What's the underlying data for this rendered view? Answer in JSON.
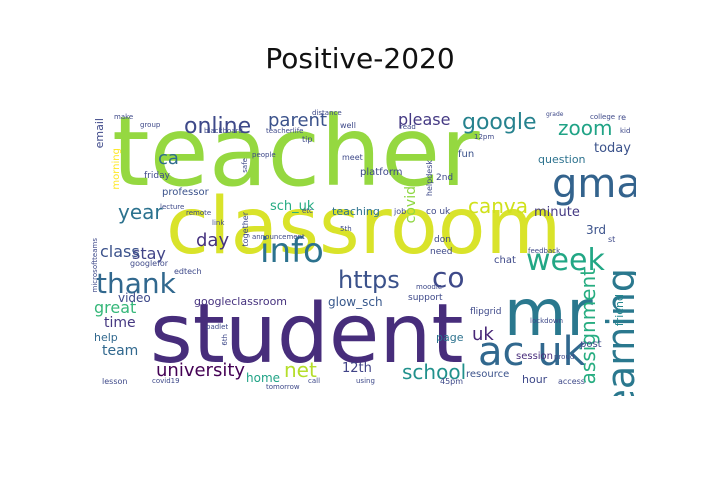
{
  "title": "Positive-2020",
  "words": [
    {
      "text": "teacher",
      "color": "#95d840",
      "orientation": "horizontal"
    },
    {
      "text": "classroom",
      "color": "#d9e32a",
      "orientation": "horizontal"
    },
    {
      "text": "student",
      "color": "#472d7b",
      "orientation": "horizontal"
    },
    {
      "text": "mr",
      "color": "#2a788e",
      "orientation": "horizontal"
    },
    {
      "text": "gmail",
      "color": "#33638d",
      "orientation": "horizontal"
    },
    {
      "text": "info",
      "color": "#2c728e",
      "orientation": "horizontal"
    },
    {
      "text": "ac uk",
      "color": "#31688e",
      "orientation": "horizontal"
    },
    {
      "text": "week",
      "color": "#22a785",
      "orientation": "horizontal"
    },
    {
      "text": "learning",
      "color": "#2a788e",
      "orientation": "vertical"
    },
    {
      "text": "https",
      "color": "#3b528b",
      "orientation": "horizontal"
    },
    {
      "text": "co",
      "color": "#3e4989",
      "orientation": "horizontal"
    },
    {
      "text": "thank",
      "color": "#31688e",
      "orientation": "horizontal"
    },
    {
      "text": "google",
      "color": "#26828e",
      "orientation": "horizontal"
    },
    {
      "text": "online",
      "color": "#3e4989",
      "orientation": "horizontal"
    },
    {
      "text": "zoom",
      "color": "#20a386",
      "orientation": "horizontal"
    },
    {
      "text": "school",
      "color": "#21918c",
      "orientation": "horizontal"
    },
    {
      "text": "net",
      "color": "#b5de2b",
      "orientation": "horizontal"
    },
    {
      "text": "assignment",
      "color": "#27ad81",
      "orientation": "vertical"
    },
    {
      "text": "parent",
      "color": "#3b528b",
      "orientation": "horizontal"
    },
    {
      "text": "please",
      "color": "#443983",
      "orientation": "horizontal"
    },
    {
      "text": "canva",
      "color": "#d0e11c",
      "orientation": "horizontal"
    },
    {
      "text": "year",
      "color": "#2c728e",
      "orientation": "horizontal"
    },
    {
      "text": "university",
      "color": "#440154",
      "orientation": "horizontal"
    },
    {
      "text": "day",
      "color": "#46337f",
      "orientation": "horizontal"
    },
    {
      "text": "ca",
      "color": "#2f6c8e",
      "orientation": "horizontal"
    },
    {
      "text": "stay",
      "color": "#414487",
      "orientation": "horizontal"
    },
    {
      "text": "class",
      "color": "#3b528b",
      "orientation": "horizontal"
    },
    {
      "text": "great",
      "color": "#35b779",
      "orientation": "horizontal"
    },
    {
      "text": "time",
      "color": "#453781",
      "orientation": "horizontal"
    },
    {
      "text": "team",
      "color": "#31688e",
      "orientation": "horizontal"
    },
    {
      "text": "video",
      "color": "#3e4989",
      "orientation": "horizontal"
    },
    {
      "text": "help",
      "color": "#31688e",
      "orientation": "horizontal"
    },
    {
      "text": "uk",
      "color": "#482677",
      "orientation": "horizontal"
    },
    {
      "text": "12th",
      "color": "#414487",
      "orientation": "horizontal"
    },
    {
      "text": "home",
      "color": "#20a386",
      "orientation": "horizontal"
    },
    {
      "text": "today",
      "color": "#3b528b",
      "orientation": "horizontal"
    },
    {
      "text": "minute",
      "color": "#443983",
      "orientation": "horizontal"
    },
    {
      "text": "question",
      "color": "#2c728e",
      "orientation": "horizontal"
    },
    {
      "text": "sch_uk",
      "color": "#25ab82",
      "orientation": "horizontal"
    },
    {
      "text": "teaching",
      "color": "#2c728e",
      "orientation": "horizontal"
    },
    {
      "text": "covid",
      "color": "#8fd744",
      "orientation": "vertical"
    },
    {
      "text": "glow_sch",
      "color": "#38588c",
      "orientation": "horizontal"
    },
    {
      "text": "googleclassroom",
      "color": "#46327e",
      "orientation": "horizontal"
    },
    {
      "text": "email",
      "color": "#3e4989",
      "orientation": "vertical"
    },
    {
      "text": "friend",
      "color": "#24868e",
      "orientation": "vertical"
    },
    {
      "text": "3rd",
      "color": "#3b528b",
      "orientation": "horizontal"
    },
    {
      "text": "hour",
      "color": "#3e4989",
      "orientation": "horizontal"
    },
    {
      "text": "session",
      "color": "#472c7a",
      "orientation": "horizontal"
    },
    {
      "text": "post",
      "color": "#3e4989",
      "orientation": "horizontal"
    },
    {
      "text": "page",
      "color": "#2c728e",
      "orientation": "horizontal"
    },
    {
      "text": "resource",
      "color": "#3b528b",
      "orientation": "horizontal"
    },
    {
      "text": "professor",
      "color": "#3b528b",
      "orientation": "horizontal"
    },
    {
      "text": "platform",
      "color": "#3e4989",
      "orientation": "horizontal"
    },
    {
      "text": "morning",
      "color": "#fde725",
      "orientation": "vertical"
    },
    {
      "text": "friday",
      "color": "#3e4989",
      "orientation": "horizontal"
    },
    {
      "text": "fun",
      "color": "#3b528b",
      "orientation": "horizontal"
    },
    {
      "text": "chat",
      "color": "#3e4989",
      "orientation": "horizontal"
    },
    {
      "text": "need",
      "color": "#3e4989",
      "orientation": "horizontal"
    },
    {
      "text": "don",
      "color": "#3e4989",
      "orientation": "horizontal"
    },
    {
      "text": "flipgrid",
      "color": "#3e4989",
      "orientation": "horizontal"
    },
    {
      "text": "support",
      "color": "#3e4989",
      "orientation": "horizontal"
    },
    {
      "text": "co uk",
      "color": "#3e4989",
      "orientation": "horizontal"
    },
    {
      "text": "job",
      "color": "#3e4989",
      "orientation": "horizontal"
    },
    {
      "text": "2nd",
      "color": "#3e4989",
      "orientation": "horizontal"
    },
    {
      "text": "meet",
      "color": "#3e4989",
      "orientation": "horizontal"
    },
    {
      "text": "well",
      "color": "#3e4989",
      "orientation": "horizontal"
    },
    {
      "text": "tip",
      "color": "#3e4989",
      "orientation": "horizontal"
    },
    {
      "text": "blackboard",
      "color": "#3e4989",
      "orientation": "horizontal"
    },
    {
      "text": "teacherlife",
      "color": "#3e4989",
      "orientation": "horizontal"
    },
    {
      "text": "make",
      "color": "#3e4989",
      "orientation": "horizontal"
    },
    {
      "text": "group",
      "color": "#3e4989",
      "orientation": "horizontal"
    },
    {
      "text": "people",
      "color": "#3e4989",
      "orientation": "horizontal"
    },
    {
      "text": "distance",
      "color": "#3e4989",
      "orientation": "horizontal"
    },
    {
      "text": "together",
      "color": "#3e4989",
      "orientation": "vertical"
    },
    {
      "text": "helpdesk",
      "color": "#3e4989",
      "orientation": "vertical"
    },
    {
      "text": "microsoftteams",
      "color": "#3e4989",
      "orientation": "vertical"
    },
    {
      "text": "lecture",
      "color": "#3e4989",
      "orientation": "horizontal"
    },
    {
      "text": "remote",
      "color": "#3e4989",
      "orientation": "horizontal"
    },
    {
      "text": "link",
      "color": "#3e4989",
      "orientation": "horizontal"
    },
    {
      "text": "googlefor",
      "color": "#3e4989",
      "orientation": "horizontal"
    },
    {
      "text": "edtech",
      "color": "#3e4989",
      "orientation": "horizontal"
    },
    {
      "text": "announcement",
      "color": "#3e4989",
      "orientation": "horizontal"
    },
    {
      "text": "padlet",
      "color": "#3e4989",
      "orientation": "horizontal"
    },
    {
      "text": "moodle",
      "color": "#3e4989",
      "orientation": "horizontal"
    },
    {
      "text": "feedback",
      "color": "#3e4989",
      "orientation": "horizontal"
    },
    {
      "text": "lockdown",
      "color": "#3e4989",
      "orientation": "horizontal"
    },
    {
      "text": "proud",
      "color": "#3e4989",
      "orientation": "horizontal"
    },
    {
      "text": "lesson",
      "color": "#3e4989",
      "orientation": "horizontal"
    },
    {
      "text": "covid19",
      "color": "#3e4989",
      "orientation": "horizontal"
    },
    {
      "text": "tomorrow",
      "color": "#3e4989",
      "orientation": "horizontal"
    },
    {
      "text": "call",
      "color": "#3e4989",
      "orientation": "horizontal"
    },
    {
      "text": "using",
      "color": "#3e4989",
      "orientation": "horizontal"
    },
    {
      "text": "access",
      "color": "#3e4989",
      "orientation": "horizontal"
    },
    {
      "text": "45pm",
      "color": "#3e4989",
      "orientation": "horizontal"
    },
    {
      "text": "12pm",
      "color": "#3e4989",
      "orientation": "horizontal"
    },
    {
      "text": "college",
      "color": "#3e4989",
      "orientation": "horizontal"
    },
    {
      "text": "grade",
      "color": "#3e4989",
      "orientation": "horizontal"
    },
    {
      "text": "kid",
      "color": "#3e4989",
      "orientation": "horizontal"
    },
    {
      "text": "re",
      "color": "#3e4989",
      "orientation": "horizontal"
    },
    {
      "text": "read",
      "color": "#3e4989",
      "orientation": "horizontal"
    },
    {
      "text": "etc",
      "color": "#3e4989",
      "orientation": "horizontal"
    },
    {
      "text": "6th",
      "color": "#3e4989",
      "orientation": "vertical"
    },
    {
      "text": "st",
      "color": "#3e4989",
      "orientation": "horizontal"
    },
    {
      "text": "safe",
      "color": "#3e4989",
      "orientation": "vertical"
    },
    {
      "text": "5th",
      "color": "#3e4989",
      "orientation": "horizontal"
    }
  ]
}
